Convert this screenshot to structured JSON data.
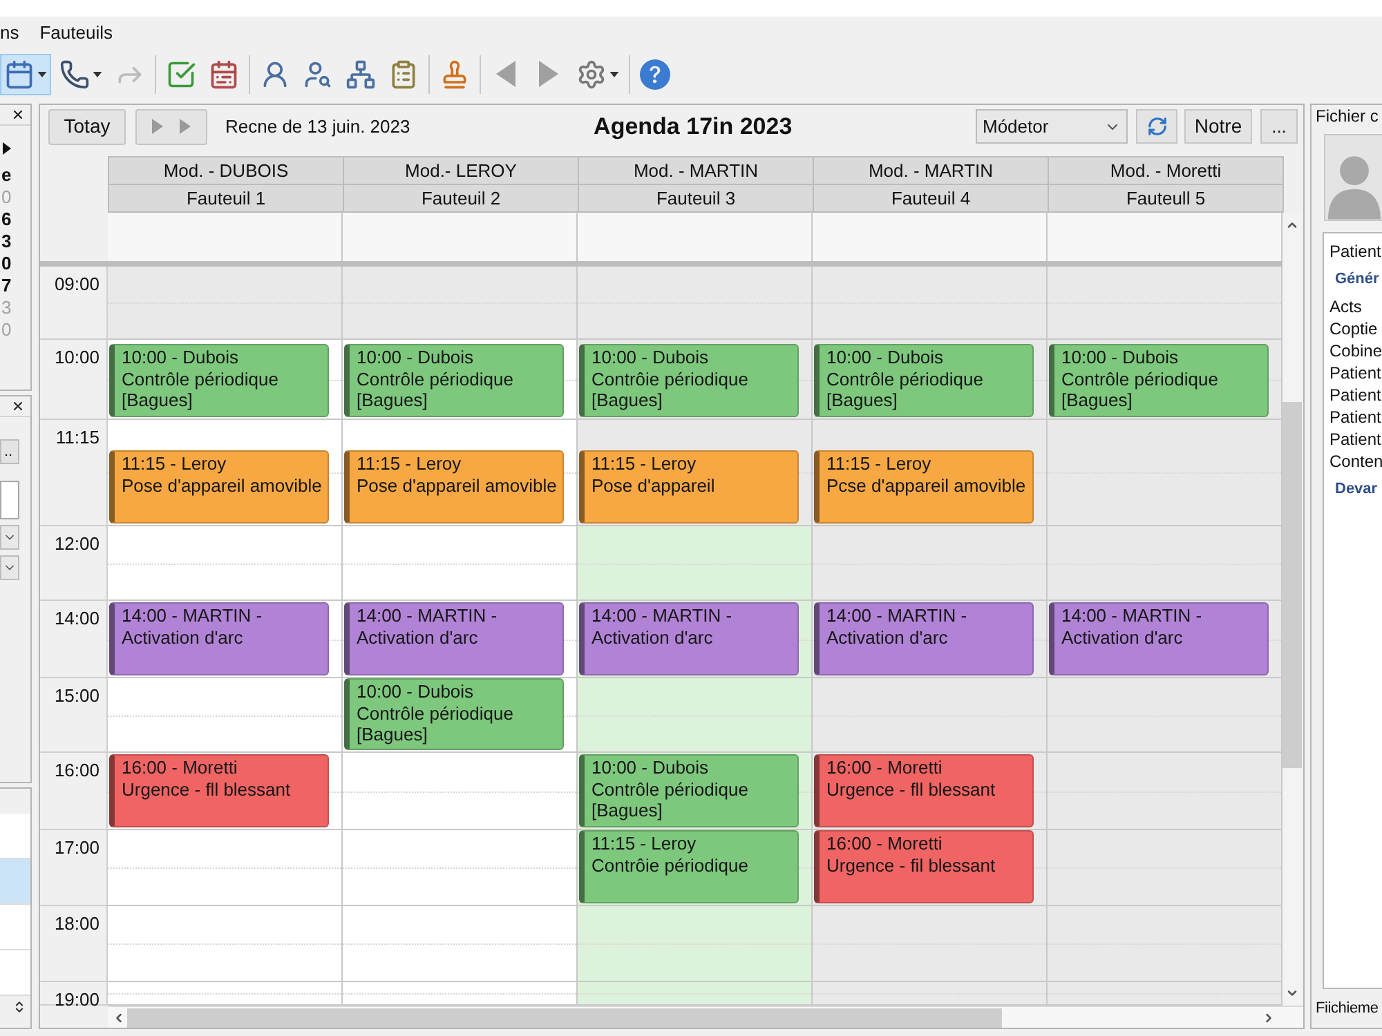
{
  "menu": [
    {
      "label": "ns"
    },
    {
      "label": "Fauteuils"
    }
  ],
  "toolbar": {
    "groups": [
      [
        {
          "kind": "calendar",
          "selected": true,
          "disabled": false,
          "menu": true
        },
        {
          "kind": "phone",
          "selected": false,
          "disabled": false,
          "menu": true
        },
        {
          "kind": "forward",
          "selected": false,
          "disabled": true,
          "menu": false
        }
      ],
      [
        {
          "kind": "checklist",
          "selected": false,
          "disabled": false,
          "menu": false
        },
        {
          "kind": "schedule",
          "selected": false,
          "disabled": false,
          "menu": false
        }
      ],
      [
        {
          "kind": "person",
          "selected": false,
          "disabled": false,
          "menu": false
        },
        {
          "kind": "person_search",
          "selected": false,
          "disabled": false,
          "menu": false
        },
        {
          "kind": "network",
          "selected": false,
          "disabled": false,
          "menu": false
        },
        {
          "kind": "form",
          "selected": false,
          "disabled": false,
          "menu": false
        }
      ],
      [
        {
          "kind": "stamp",
          "selected": false,
          "disabled": false,
          "menu": false
        }
      ],
      [
        {
          "kind": "previous",
          "selected": false,
          "disabled": false,
          "menu": false
        },
        {
          "kind": "next",
          "selected": false,
          "disabled": false,
          "menu": false
        },
        {
          "kind": "settings",
          "selected": false,
          "disabled": false,
          "menu": true
        }
      ],
      [
        {
          "kind": "help",
          "selected": false,
          "disabled": false,
          "menu": false
        }
      ]
    ]
  },
  "left_sidebar": {
    "calendar_panel": {
      "days": [
        {
          "text": "e",
          "dimmed": false
        },
        {
          "text": "0",
          "dimmed": true
        },
        {
          "text": "6",
          "dimmed": false
        },
        {
          "text": "3",
          "dimmed": false
        },
        {
          "text": "0",
          "dimmed": false
        },
        {
          "text": "7",
          "dimmed": false
        },
        {
          "text": "3",
          "dimmed": true
        },
        {
          "text": "0",
          "dimmed": true
        }
      ]
    },
    "filter_panel": {
      "button": ".."
    },
    "list_panel": {
      "rows": [
        {
          "selected": false
        },
        {
          "selected": true
        },
        {
          "selected": false
        },
        {
          "selected": false
        }
      ]
    }
  },
  "agenda": {
    "today_button": "Totay",
    "range_label": "Recne de 13 juin. 2023",
    "title": "Agenda 17in 2023",
    "view_select": {
      "value": "Módetor"
    },
    "note_button": "Notre",
    "more_button": "...",
    "time_slots": [
      {
        "label": "09:00"
      },
      {
        "label": "10:00"
      },
      {
        "label": "11:15"
      },
      {
        "label": "12:00"
      },
      {
        "label": "14:00"
      },
      {
        "label": "15:00"
      },
      {
        "label": "16:00"
      },
      {
        "label": "17:00"
      },
      {
        "label": "18:00"
      },
      {
        "label": "19:00"
      }
    ],
    "columns": [
      {
        "practitioner": "Mod. - DUBOIS",
        "chair": "Fauteuil 1",
        "cells": [
          {
            "kind": "unavailable"
          },
          {
            "kind": "available",
            "appointments": [
              {
                "color": "#7dc87d",
                "lines": [
                  "10:00 - Dubois",
                  "Contrôle périodique",
                  "[Bagues]"
                ]
              }
            ]
          },
          {
            "kind": "available",
            "appointments": [
              {
                "color": "#f7a842",
                "lines": [
                  "11:15 - Leroy",
                  "Pose d'appareil amovible"
                ]
              }
            ]
          },
          {
            "kind": "available"
          },
          {
            "kind": "available",
            "appointments": [
              {
                "color": "#b183d6",
                "lines": [
                  "14:00 - MARTIN -",
                  "Activation d'arc"
                ]
              }
            ]
          },
          {
            "kind": "available"
          },
          {
            "kind": "available",
            "appointments": [
              {
                "color": "#f06464",
                "lines": [
                  "16:00 - Moretti",
                  "Urgence - fll blessant"
                ]
              }
            ]
          },
          {
            "kind": "available"
          },
          {
            "kind": "available"
          },
          {
            "kind": "available"
          }
        ]
      },
      {
        "practitioner": "Mod.- LEROY",
        "chair": "Fauteuil 2",
        "cells": [
          {
            "kind": "unavailable"
          },
          {
            "kind": "available",
            "appointments": [
              {
                "color": "#7dc87d",
                "lines": [
                  "10:00 - Dubois",
                  "Contrôle périodique",
                  "[Bagues]"
                ]
              }
            ]
          },
          {
            "kind": "available",
            "appointments": [
              {
                "color": "#f7a842",
                "lines": [
                  "11:15 - Leroy",
                  "Pose d'appareil amovible"
                ]
              }
            ]
          },
          {
            "kind": "available"
          },
          {
            "kind": "available",
            "appointments": [
              {
                "color": "#b183d6",
                "lines": [
                  "14:00 - MARTIN -",
                  "Activation d'arc"
                ]
              }
            ]
          },
          {
            "kind": "available",
            "appointments": [
              {
                "color": "#7dc87d",
                "lines": [
                  "10:00 - Dubois",
                  "Contrôle périodique",
                  "[Bagues]"
                ]
              }
            ]
          },
          {
            "kind": "available"
          },
          {
            "kind": "available"
          },
          {
            "kind": "available"
          },
          {
            "kind": "available"
          }
        ]
      },
      {
        "practitioner": "Mod. - MARTIN",
        "chair": "Fauteuil 3",
        "cells": [
          {
            "kind": "unavailable"
          },
          {
            "kind": "unavailable",
            "appointments": [
              {
                "color": "#7dc87d",
                "lines": [
                  "10:00 - Dubois",
                  "Contrôie périodique",
                  "[Bagues]"
                ]
              }
            ]
          },
          {
            "kind": "unavailable",
            "appointments": [
              {
                "color": "#f7a842",
                "lines": [
                  "11:15 - Leroy",
                  "Pose d'appareil"
                ]
              }
            ]
          },
          {
            "kind": "selected"
          },
          {
            "kind": "selected",
            "appointments": [
              {
                "color": "#b183d6",
                "lines": [
                  "14:00 - MARTIN -",
                  "Activation d'arc"
                ]
              }
            ]
          },
          {
            "kind": "selected"
          },
          {
            "kind": "selected",
            "appointments": [
              {
                "color": "#7dc87d",
                "lines": [
                  "10:00 - Dubois",
                  "Contrôle périodique",
                  "[Bagues]"
                ]
              }
            ]
          },
          {
            "kind": "selected",
            "appointments": [
              {
                "color": "#7dc87d",
                "lines": [
                  "11:15 - Leroy",
                  "Contrôie périodique"
                ]
              }
            ]
          },
          {
            "kind": "selected"
          },
          {
            "kind": "selected"
          }
        ]
      },
      {
        "practitioner": "Mod. - MARTIN",
        "chair": "Fauteuil 4",
        "cells": [
          {
            "kind": "unavailable"
          },
          {
            "kind": "unavailable",
            "appointments": [
              {
                "color": "#7dc87d",
                "lines": [
                  "10:00 - Dubois",
                  "Contrôle périodique",
                  "[Bagues]"
                ]
              }
            ]
          },
          {
            "kind": "unavailable",
            "appointments": [
              {
                "color": "#f7a842",
                "lines": [
                  "11:15 - Leroy",
                  "Pcse d'appareil amovible"
                ]
              }
            ]
          },
          {
            "kind": "unavailable"
          },
          {
            "kind": "unavailable",
            "appointments": [
              {
                "color": "#b183d6",
                "lines": [
                  "14:00 - MARTIN -",
                  "Activation d'arc"
                ]
              }
            ]
          },
          {
            "kind": "unavailable"
          },
          {
            "kind": "unavailable",
            "appointments": [
              {
                "color": "#f06464",
                "lines": [
                  "16:00 - Moretti",
                  "Urgence - fll blessant"
                ]
              }
            ]
          },
          {
            "kind": "unavailable",
            "appointments": [
              {
                "color": "#f06464",
                "lines": [
                  "16:00 - Moretti",
                  "Urgence - fil blessant"
                ]
              }
            ]
          },
          {
            "kind": "unavailable"
          },
          {
            "kind": "unavailable"
          }
        ]
      },
      {
        "practitioner": "Mod. - Moretti",
        "chair": "Fauteull 5",
        "cells": [
          {
            "kind": "unavailable"
          },
          {
            "kind": "unavailable",
            "appointments": [
              {
                "color": "#7dc87d",
                "lines": [
                  "10:00 - Dubois",
                  "Contrôle périodique",
                  "[Bagues]"
                ]
              }
            ]
          },
          {
            "kind": "unavailable"
          },
          {
            "kind": "unavailable"
          },
          {
            "kind": "unavailable",
            "appointments": [
              {
                "color": "#b183d6",
                "lines": [
                  "14:00 - MARTIN -",
                  "Activation d'arc"
                ]
              }
            ]
          },
          {
            "kind": "unavailable"
          },
          {
            "kind": "unavailable"
          },
          {
            "kind": "unavailable"
          },
          {
            "kind": "unavailable"
          },
          {
            "kind": "unavailable"
          }
        ]
      }
    ]
  },
  "patient_panel": {
    "title": "Fichier c",
    "items": [
      {
        "kind": "item",
        "text": "Patient"
      },
      {
        "kind": "heading",
        "text": "Génér"
      },
      {
        "kind": "item",
        "text": "Acts"
      },
      {
        "kind": "item",
        "text": "Coptie"
      },
      {
        "kind": "item",
        "text": "Cobine"
      },
      {
        "kind": "item",
        "text": "Patient"
      },
      {
        "kind": "item",
        "text": "Patient"
      },
      {
        "kind": "item",
        "text": "Patient"
      },
      {
        "kind": "item",
        "text": "Patient"
      },
      {
        "kind": "item",
        "text": "Conten"
      },
      {
        "kind": "heading",
        "text": "Devar"
      }
    ],
    "footer": "Fiichieme"
  }
}
